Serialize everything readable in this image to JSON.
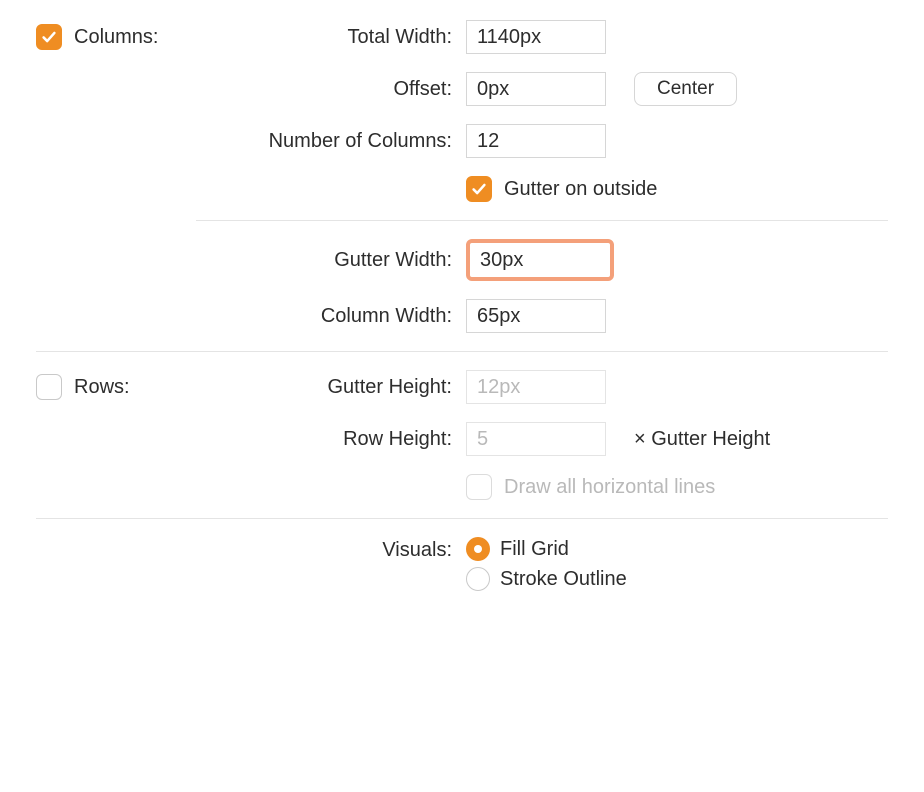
{
  "columns": {
    "section_label": "Columns:",
    "total_width": {
      "label": "Total Width:",
      "value": "1140px"
    },
    "offset": {
      "label": "Offset:",
      "value": "0px",
      "center_button": "Center"
    },
    "num_columns": {
      "label": "Number of Columns:",
      "value": "12"
    },
    "gutter_outside": {
      "label": "Gutter on outside",
      "checked": true
    },
    "gutter_width": {
      "label": "Gutter Width:",
      "value": "30px"
    },
    "column_width": {
      "label": "Column Width:",
      "value": "65px"
    },
    "checked": true
  },
  "rows": {
    "section_label": "Rows:",
    "gutter_height": {
      "label": "Gutter Height:",
      "value": "12px"
    },
    "row_height": {
      "label": "Row Height:",
      "value": "5",
      "suffix": "× Gutter Height"
    },
    "draw_all": {
      "label": "Draw all horizontal lines",
      "checked": false
    },
    "checked": false
  },
  "visuals": {
    "label": "Visuals:",
    "options": [
      "Fill Grid",
      "Stroke Outline"
    ],
    "selected": 0
  }
}
